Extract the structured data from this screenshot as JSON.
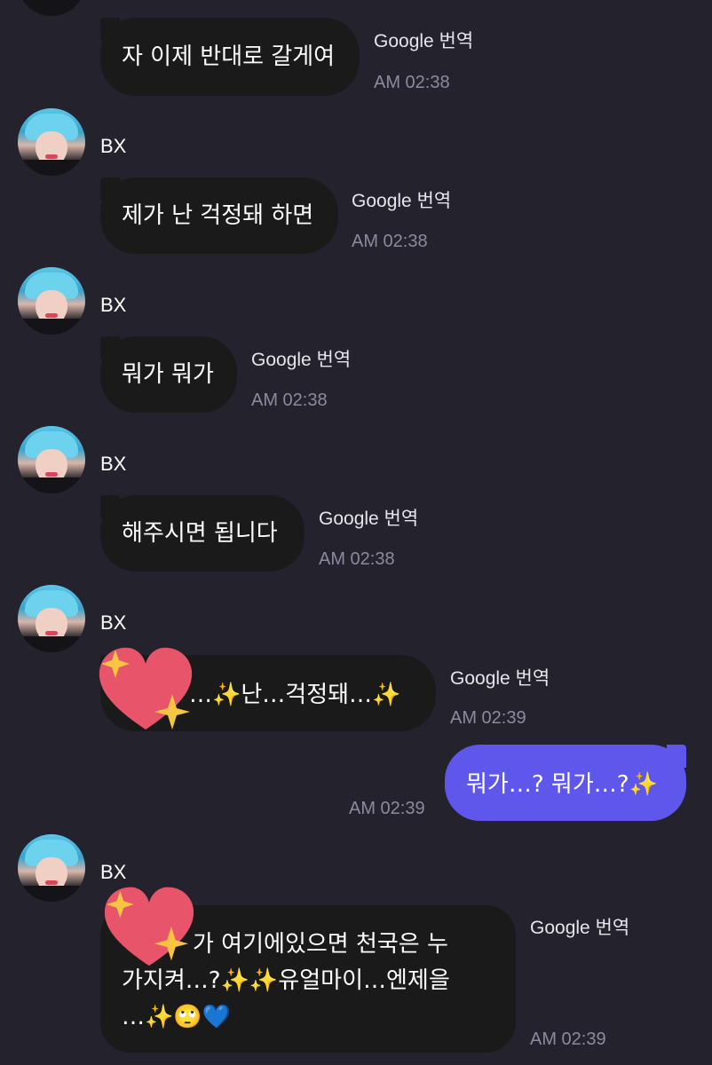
{
  "chat": {
    "sender_name": "BX",
    "translate_label": "Google 번역",
    "messages": [
      {
        "text": "자 이제 반대로 갈게여",
        "time": "AM 02:38"
      },
      {
        "text": "제가 난 걱정돼 하면",
        "time": "AM 02:38"
      },
      {
        "text": "뭐가 뭐가",
        "time": "AM 02:38"
      },
      {
        "text": "해주시면 됩니다",
        "time": "AM 02:38"
      },
      {
        "text": "…✨난…걱정돼…✨",
        "time": "AM 02:39"
      },
      {
        "text": "뭐가…? 뭐가…?✨",
        "time": "AM 02:39"
      },
      {
        "text": "가 여기에있으면 천국은 누\n가지켜…?✨✨유얼마이…엔제을\n…✨🙄💙",
        "time": "AM 02:39"
      }
    ]
  },
  "colors": {
    "background": "#23222d",
    "received_bubble": "#1a1a1a",
    "sent_bubble": "#5f57eb",
    "timestamp": "#8d8a9e"
  },
  "icons": [
    "avatar",
    "heart-sticker-icon",
    "sparkle-icon"
  ]
}
